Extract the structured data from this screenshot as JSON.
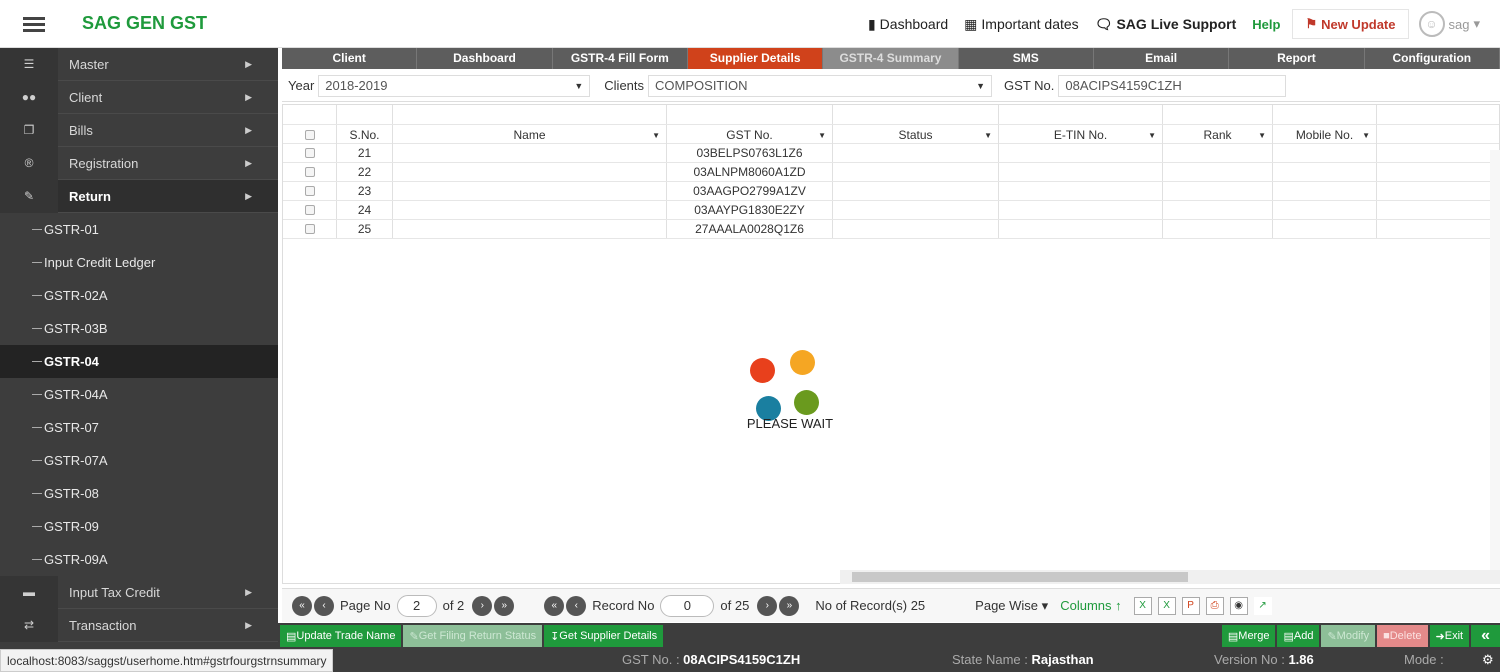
{
  "app_title": "SAG GEN GST",
  "topnav": {
    "dashboard": "Dashboard",
    "important_dates": "Important dates",
    "live_support": "SAG Live Support",
    "help": "Help",
    "new_update": "New Update",
    "user": "sag"
  },
  "sidebar": {
    "items": [
      {
        "label": "Master",
        "icon": "list-icon"
      },
      {
        "label": "Client",
        "icon": "users-icon"
      },
      {
        "label": "Bills",
        "icon": "copy-icon"
      },
      {
        "label": "Registration",
        "icon": "registered-icon"
      },
      {
        "label": "Return",
        "icon": "edit-icon"
      }
    ],
    "sub_items": [
      "GSTR-01",
      "Input Credit Ledger",
      "GSTR-02A",
      "GSTR-03B",
      "GSTR-04",
      "GSTR-04A",
      "GSTR-07",
      "GSTR-07A",
      "GSTR-08",
      "GSTR-09",
      "GSTR-09A"
    ],
    "selected_sub": "GSTR-04",
    "bottom_items": [
      {
        "label": "Input Tax Credit",
        "icon": "card-icon"
      },
      {
        "label": "Transaction",
        "icon": "exchange-icon"
      }
    ]
  },
  "tabs": [
    "Client",
    "Dashboard",
    "GSTR-4 Fill Form",
    "Supplier Details",
    "GSTR-4 Summary",
    "SMS",
    "Email",
    "Report",
    "Configuration"
  ],
  "active_tab": "Supplier Details",
  "filters": {
    "year_label": "Year",
    "year_value": "2018-2019",
    "clients_label": "Clients",
    "clients_value": "COMPOSITION",
    "gst_label": "GST No.",
    "gst_value": "08ACIPS4159C1ZH"
  },
  "grid": {
    "columns": [
      "S.No.",
      "Name",
      "GST No.",
      "Status",
      "E-TIN No.",
      "Rank",
      "Mobile No."
    ],
    "rows": [
      {
        "sno": "21",
        "name": "",
        "gst": "03BELPS0763L1Z6"
      },
      {
        "sno": "22",
        "name": "",
        "gst": "03ALNPM8060A1ZD"
      },
      {
        "sno": "23",
        "name": "",
        "gst": "03AAGPO2799A1ZV"
      },
      {
        "sno": "24",
        "name": "",
        "gst": "03AAYPG1830E2ZY"
      },
      {
        "sno": "25",
        "name": "",
        "gst": "27AAALA0028Q1Z6"
      }
    ]
  },
  "loader": {
    "text": "PLEASE WAIT",
    "colors": [
      "#e8401c",
      "#f5a623",
      "#1a7fa0",
      "#6a9a1e"
    ]
  },
  "pager": {
    "page_label": "Page No",
    "page_value": "2",
    "page_of": "of 2",
    "record_label": "Record No",
    "record_value": "0",
    "record_of": "of 25",
    "count": "No of Record(s) 25",
    "page_wise": "Page Wise",
    "columns": "Columns"
  },
  "actions": {
    "update_trade": "Update Trade Name",
    "get_filing": "Get Filing Return Status",
    "get_supplier": "Get Supplier Details",
    "merge": "Merge",
    "add": "Add",
    "modify": "Modify",
    "delete": "Delete",
    "exit": "Exit"
  },
  "status": {
    "url": "localhost:8083/saggst/userhome.htm#gstrfourgstrnsummary",
    "gst_label": "GST No. : ",
    "gst_value": "08ACIPS4159C1ZH",
    "state_label": "State Name : ",
    "state_value": "Rajasthan",
    "version_label": "Version No : ",
    "version_value": "1.86",
    "mode_label": "Mode : "
  }
}
